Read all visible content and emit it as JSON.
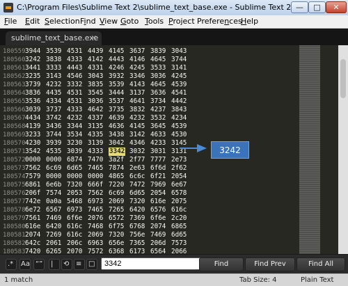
{
  "window": {
    "title": "C:\\Program Files\\Sublime Text 2\\sublime_text_base.exe - Sublime Text 2",
    "controls": {
      "minimize": "—",
      "maximize": "□",
      "close": "✕"
    }
  },
  "menu": {
    "items": [
      {
        "label": "File",
        "underline": "F"
      },
      {
        "label": "Edit",
        "underline": "E"
      },
      {
        "label": "Selection",
        "underline": "S"
      },
      {
        "label": "Find",
        "underline": "i"
      },
      {
        "label": "View",
        "underline": "V"
      },
      {
        "label": "Goto",
        "underline": "G"
      },
      {
        "label": "Tools",
        "underline": "T"
      },
      {
        "label": "Project",
        "underline": "P"
      },
      {
        "label": "Preferences",
        "underline": "n"
      },
      {
        "label": "Help",
        "underline": "H"
      }
    ]
  },
  "tabs": [
    {
      "label": "sublime_text_base.exe",
      "close": "×"
    }
  ],
  "editor": {
    "lines": [
      {
        "num": "180559",
        "tokens": [
          "3944",
          "3539",
          "4531",
          "4439",
          "4145",
          "3637",
          "3839",
          "3043"
        ]
      },
      {
        "num": "180560",
        "tokens": [
          "3242",
          "3838",
          "4333",
          "4142",
          "4443",
          "4146",
          "4645",
          "3744"
        ]
      },
      {
        "num": "180561",
        "tokens": [
          "3441",
          "3333",
          "4443",
          "4331",
          "4246",
          "4245",
          "3533",
          "3141"
        ]
      },
      {
        "num": "180562",
        "tokens": [
          "3235",
          "3143",
          "4546",
          "3043",
          "3932",
          "3346",
          "3036",
          "4245"
        ]
      },
      {
        "num": "180563",
        "tokens": [
          "3739",
          "4232",
          "3332",
          "3835",
          "3539",
          "4143",
          "4645",
          "4539"
        ]
      },
      {
        "num": "180564",
        "tokens": [
          "3836",
          "4435",
          "4531",
          "3545",
          "3444",
          "3137",
          "3636",
          "4541"
        ]
      },
      {
        "num": "180565",
        "tokens": [
          "3536",
          "4334",
          "4531",
          "3036",
          "3537",
          "4641",
          "3734",
          "4442"
        ]
      },
      {
        "num": "180566",
        "tokens": [
          "3039",
          "3737",
          "4333",
          "4642",
          "3735",
          "3832",
          "4237",
          "3843"
        ]
      },
      {
        "num": "180567",
        "tokens": [
          "4434",
          "3742",
          "4232",
          "4337",
          "4639",
          "4232",
          "3532",
          "4234"
        ]
      },
      {
        "num": "180568",
        "tokens": [
          "4139",
          "3436",
          "3344",
          "3135",
          "4636",
          "4145",
          "3645",
          "4539"
        ]
      },
      {
        "num": "180569",
        "tokens": [
          "3233",
          "3744",
          "3534",
          "4335",
          "3438",
          "3142",
          "4633",
          "4530"
        ]
      },
      {
        "num": "180570",
        "tokens": [
          "4230",
          "3939",
          "3230",
          "3139",
          "3042",
          "4346",
          "4233",
          "3145"
        ]
      },
      {
        "num": "180571",
        "tokens": [
          "3542",
          "4535",
          "3039",
          "4333",
          "3342",
          "3032",
          "3031",
          "3131"
        ]
      },
      {
        "num": "180572",
        "tokens": [
          "0000",
          "0000",
          "6874",
          "7470",
          "3a2f",
          "2f77",
          "7777",
          "2e73"
        ]
      },
      {
        "num": "180573",
        "tokens": [
          "7562",
          "6c69",
          "6d65",
          "7465",
          "7874",
          "2e63",
          "6f6d",
          "2f62"
        ]
      },
      {
        "num": "180574",
        "tokens": [
          "7579",
          "0000",
          "0000",
          "0000",
          "4865",
          "6c6c",
          "6f21",
          "2054"
        ]
      },
      {
        "num": "180575",
        "tokens": [
          "6861",
          "6e6b",
          "7320",
          "666f",
          "7220",
          "7472",
          "7969",
          "6e67"
        ]
      },
      {
        "num": "180576",
        "tokens": [
          "206f",
          "7574",
          "2053",
          "7562",
          "6c69",
          "6d65",
          "2054",
          "6578"
        ]
      },
      {
        "num": "180577",
        "tokens": [
          "742e",
          "0a0a",
          "5468",
          "6973",
          "2069",
          "7320",
          "616e",
          "2075"
        ]
      },
      {
        "num": "180578",
        "tokens": [
          "6e72",
          "6567",
          "6973",
          "7465",
          "7265",
          "6420",
          "6576",
          "616c"
        ]
      },
      {
        "num": "180579",
        "tokens": [
          "7561",
          "7469",
          "6f6e",
          "2076",
          "6572",
          "7369",
          "6f6e",
          "2c20"
        ]
      },
      {
        "num": "180580",
        "tokens": [
          "616e",
          "6420",
          "616c",
          "7468",
          "6f75",
          "6768",
          "2074",
          "6865"
        ]
      },
      {
        "num": "180581",
        "tokens": [
          "2074",
          "7269",
          "616c",
          "2069",
          "7320",
          "756e",
          "7469",
          "6d65"
        ]
      },
      {
        "num": "180582",
        "tokens": [
          "642c",
          "2061",
          "206c",
          "6963",
          "656e",
          "7365",
          "206d",
          "7573"
        ]
      },
      {
        "num": "180583",
        "tokens": [
          "7420",
          "6265",
          "2070",
          "7572",
          "6368",
          "6173",
          "6564",
          "2066"
        ]
      }
    ]
  },
  "callout": {
    "text": "3242"
  },
  "find_panel": {
    "options": {
      "regex": ".*",
      "case": "Aa",
      "quotes": "“”",
      "wrap": "⟲",
      "highlight": "□"
    },
    "value": "3342",
    "buttons": {
      "find": "Find",
      "find_prev": "Find Prev",
      "find_all": "Find All"
    }
  },
  "status": {
    "left": "1 match",
    "tab_size": "Tab Size: 4",
    "syntax": "Plain Text"
  }
}
